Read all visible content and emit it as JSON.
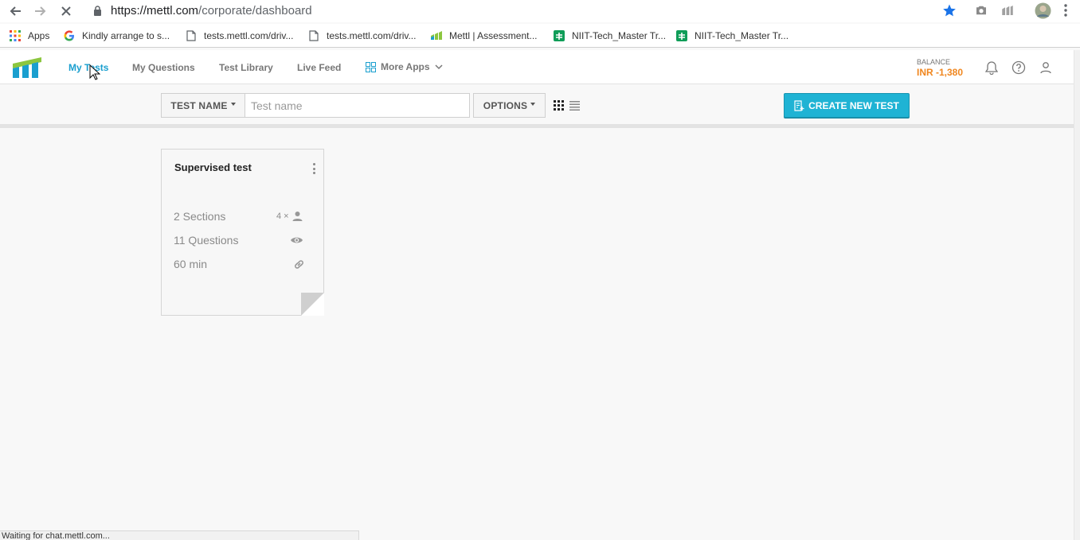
{
  "browser": {
    "url_host": "https://mettl.com",
    "url_path": "/corporate/dashboard",
    "bookmarks": [
      {
        "label": "Apps",
        "icon": "apps-grid-icon"
      },
      {
        "label": "Kindly arrange to s...",
        "icon": "google-icon"
      },
      {
        "label": "tests.mettl.com/driv...",
        "icon": "page-icon"
      },
      {
        "label": "tests.mettl.com/driv...",
        "icon": "page-icon"
      },
      {
        "label": "Mettl | Assessment...",
        "icon": "mettl-icon"
      },
      {
        "label": "NIIT-Tech_Master Tr...",
        "icon": "sheets-icon"
      },
      {
        "label": "NIIT-Tech_Master Tr...",
        "icon": "sheets-icon"
      }
    ],
    "status_text": "Waiting for chat.mettl.com..."
  },
  "header": {
    "nav": [
      "My Tests",
      "My Questions",
      "Test Library",
      "Live Feed"
    ],
    "active_nav": "My Tests",
    "more_apps_label": "More Apps",
    "balance_label": "BALANCE",
    "balance_value": "INR -1,380"
  },
  "toolbar": {
    "filter_label": "TEST NAME",
    "search_placeholder": "Test name",
    "options_label": "OPTIONS",
    "create_label": "CREATE NEW TEST"
  },
  "tests": [
    {
      "title": "Supervised test",
      "sections": "2 Sections",
      "questions": "11 Questions",
      "duration": "60 min",
      "candidates": "4 ×"
    }
  ],
  "colors": {
    "accent": "#1a9fcf",
    "create_button": "#1fb3d4",
    "balance": "#f0861e",
    "logo_green": "#8cc63f",
    "logo_blue": "#1a9fcf"
  }
}
